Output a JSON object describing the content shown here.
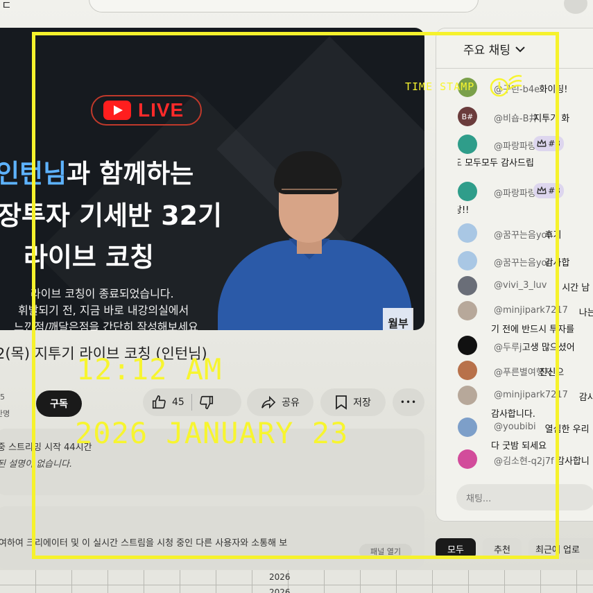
{
  "header": {
    "app_glyph": "ㄷ"
  },
  "video": {
    "live_label": "LIVE",
    "title_line1_highlight": "인턴님",
    "title_line1_rest": "과 함께하는",
    "title_line2": "장투자 기세반 32기",
    "title_line3": "라이브 코칭",
    "subtitle_line1": "라이브 코칭이 종료되었습니다.",
    "subtitle_line2": "휘발되기 전, 지금 바로 내강의실에서",
    "subtitle_line3": "느낀점/깨달은점을 간단히 작성해보세요",
    "watermark": "월부"
  },
  "below": {
    "title": "2(목) 지투기 라이브 코칭 (인턴님)",
    "channel_glyph": "5",
    "channel_sub": "만명",
    "subscribe_label": "구독",
    "like_count": "45",
    "share_label": "공유",
    "save_label": "저장",
    "more_label": "•••",
    "desc_line1": "중  스트리밍 시작 44시간",
    "desc_line2": "된 설명이 없습니다.",
    "chat_info_text": "여하여 크리에이터 및 이 실시간 스트림을 시청 중인 다른 사용자와 소통해 보",
    "panel_open_label": "패널 열기"
  },
  "sheet": {
    "cell1": "2026",
    "cell2": "2026"
  },
  "chat": {
    "header": "주요 채팅",
    "messages": [
      {
        "author": "@구린-b4e",
        "text": "화이팅!",
        "avatar_color": "#7aa04a",
        "badge": "",
        "cont": ""
      },
      {
        "author": "@비숍-B井",
        "text": "지투기 화",
        "avatar_color": "#6b3c3c",
        "badge": "",
        "avatar_label": "B#",
        "cont": ""
      },
      {
        "author": "@파랑파랑8",
        "text": "",
        "avatar_color": "#2f9d8a",
        "badge": "#3",
        "cont": "도 모두모두 감사드립"
      },
      {
        "author": "@파랑파랑8",
        "text": "",
        "avatar_color": "#2f9d8a",
        "badge": "#3",
        "cont": "당!!"
      },
      {
        "author": "@꿈꾸는음yon",
        "text": "후기",
        "avatar_color": "#a9c7e4",
        "badge": "",
        "cont": ""
      },
      {
        "author": "@꿈꾸는음yon",
        "text": "감사합",
        "avatar_color": "#a9c7e4",
        "badge": "",
        "cont": ""
      },
      {
        "author": "@vivi_3_luv",
        "text": "시간 남",
        "avatar_color": "#6a6e78",
        "badge": "",
        "cont": ""
      },
      {
        "author": "@minjipark7217",
        "text": "나는",
        "avatar_color": "#b7a89a",
        "badge": "",
        "cont": "기 전에 반드시 투자를"
      },
      {
        "author": "@두루j",
        "text": "고생 많으셨어",
        "avatar_color": "#111111",
        "badge": "",
        "cont": ""
      },
      {
        "author": "@푸른별여행자",
        "text": "진신으",
        "avatar_color": "#b8714a",
        "badge": "",
        "cont": ""
      },
      {
        "author": "@minjipark7217",
        "text": "감사",
        "avatar_color": "#b7a89a",
        "badge": "",
        "cont": "감사합니다."
      },
      {
        "author": "@youbibi",
        "text": "열심한 우리",
        "avatar_color": "#7d9fc9",
        "badge": "",
        "cont": "다 굿밤 되세요"
      },
      {
        "author": "@김소현-q2j7f",
        "text": "감사합니",
        "avatar_color": "#d24c9b",
        "badge": "",
        "cont": ""
      }
    ],
    "input_placeholder": "채팅...",
    "filters": {
      "all": "모두",
      "recommended": "추천",
      "latest": "최근에 업로"
    }
  },
  "overlay": {
    "time": "12:12 AM",
    "date": "2026 JANUARY 23",
    "stamp_label": "TIME STAMP",
    "frame_color": "#f6f22c"
  }
}
